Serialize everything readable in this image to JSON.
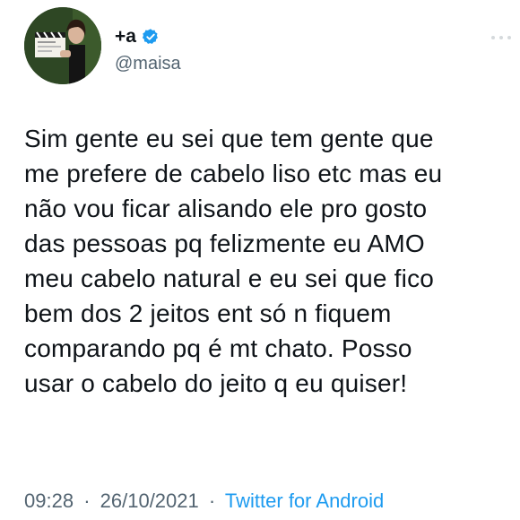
{
  "author": {
    "display_name": "+a",
    "handle": "@maisa",
    "verified": true
  },
  "tweet": {
    "lines": [
      "Sim gente eu sei que tem gente que",
      "me prefere de cabelo liso etc mas eu",
      "não vou ficar alisando ele pro gosto",
      "das pessoas pq felizmente eu AMO",
      "meu cabelo natural e eu sei que fico",
      "bem dos 2 jeitos ent só n fiquem",
      "comparando pq é mt chato. Posso",
      "usar o cabelo do jeito q eu quiser!"
    ]
  },
  "meta": {
    "time": "09:28",
    "separator": "·",
    "date": "26/10/2021",
    "source": "Twitter for Android"
  },
  "icons": {
    "verified": "verified-badge-icon",
    "more": "more-options-icon"
  },
  "colors": {
    "text": "#0f1419",
    "secondary": "#536471",
    "accent": "#1d9bf0",
    "verified": "#1d9bf0"
  }
}
